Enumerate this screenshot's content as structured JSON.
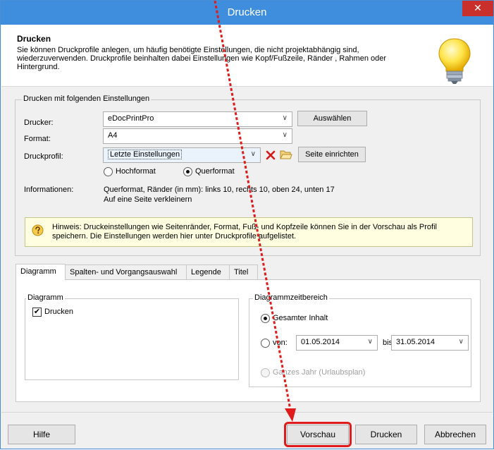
{
  "window": {
    "title": "Drucken",
    "close_glyph": "✕"
  },
  "header": {
    "title": "Drucken",
    "description": "Sie können Druckprofile anlegen, um häufig benötigte Einstellungen, die nicht projektabhängig sind, wiederzuverwenden. Druckprofile beinhalten dabei Einstellungen wie Kopf/Fußzeile, Ränder , Rahmen oder Hintergrund.",
    "icon": "lightbulb-icon"
  },
  "settings": {
    "group_label": "Drucken mit folgenden Einstellungen",
    "printer_label": "Drucker:",
    "printer_value": "eDocPrintPro",
    "select_button": "Auswählen",
    "format_label": "Format:",
    "format_value": "A4",
    "profile_label": "Druckprofil:",
    "profile_value": "Letzte Einstellungen",
    "page_setup_button": "Seite einrichten",
    "portrait_label": "Hochformat",
    "landscape_label": "Querformat",
    "orientation_selected": "landscape",
    "info_label": "Informationen:",
    "info_line1": "Querformat, Ränder (in mm): links 10, rechts 10, oben 24, unten 17",
    "info_line2": "Auf eine Seite verkleinern"
  },
  "hint": {
    "text": "Hinweis: Druckeinstellungen wie Seitenränder, Format, Fuß- und Kopfzeile können Sie in der Vorschau als Profil speichern. Die Einstellungen werden hier unter Druckprofile aufgelistet."
  },
  "tabs": [
    {
      "label": "Diagramm",
      "active": true
    },
    {
      "label": "Spalten- und Vorgangsauswahl",
      "active": false
    },
    {
      "label": "Legende",
      "active": false
    },
    {
      "label": "Titel",
      "active": false
    }
  ],
  "diagram_tab": {
    "diagram_group_label": "Diagramm",
    "print_checkbox_label": "Drucken",
    "print_checked": true,
    "range_group_label": "Diagrammzeitbereich",
    "entire_content_label": "Gesamter Inhalt",
    "from_label": "von:",
    "from_value": "01.05.2014",
    "to_label": "bis:",
    "to_value": "31.05.2014",
    "whole_year_label": "Ganzes Jahr (Urlaubsplan)"
  },
  "footer": {
    "help_button": "Hilfe",
    "preview_button": "Vorschau",
    "print_button": "Drucken",
    "cancel_button": "Abbrechen"
  },
  "colors": {
    "titlebar": "#3f8ede",
    "close": "#c9302c",
    "highlight": "#e01b1b",
    "hint_bg": "#fffee1"
  }
}
